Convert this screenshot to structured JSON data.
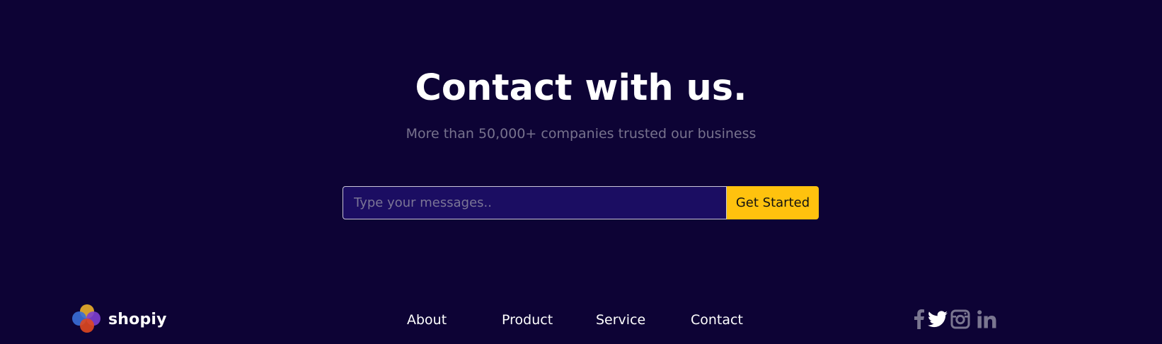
{
  "hero": {
    "title": "Contact with us.",
    "subtitle": "More than 50,000+ companies trusted our business"
  },
  "form": {
    "placeholder": "Type your messages..",
    "value": "",
    "button_label": "Get Started"
  },
  "footer": {
    "brand": "shopiy",
    "nav": [
      {
        "label": "About"
      },
      {
        "label": "Product"
      },
      {
        "label": "Service"
      },
      {
        "label": "Contact"
      }
    ],
    "social_icons": [
      "facebook-icon",
      "twitter-icon",
      "instagram-icon",
      "linkedin-icon"
    ]
  },
  "colors": {
    "background": "#0d0335",
    "input_background": "#1b0d62",
    "accent": "#ffc20e",
    "muted_text": "#77728d",
    "icon_gray": "#7a7690",
    "logo_blue": "#3a6fd8",
    "logo_yellow": "#e0a72b",
    "logo_purple": "#7e3fd0",
    "logo_orange": "#e0481f"
  }
}
